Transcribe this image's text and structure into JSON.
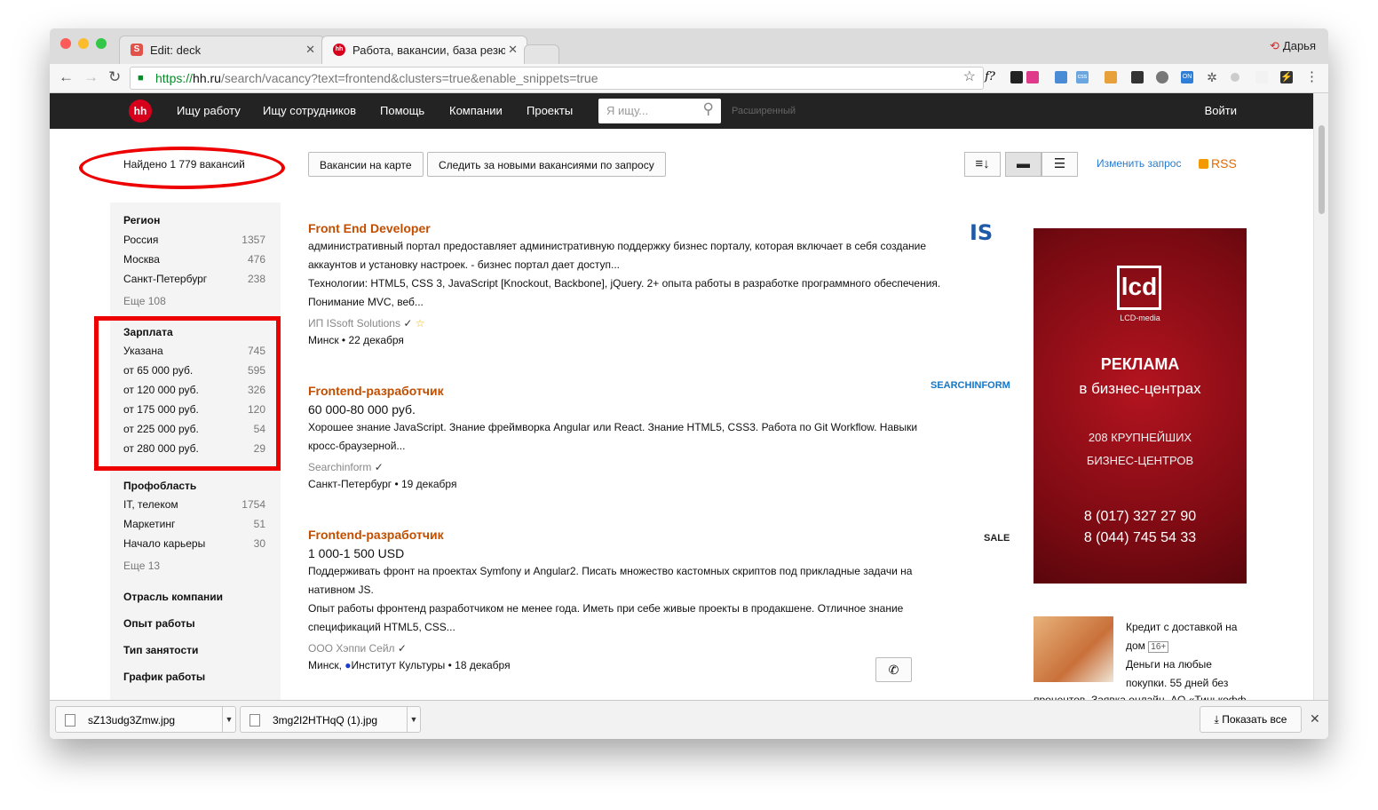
{
  "browser": {
    "tabs": [
      {
        "title": "Edit: deck",
        "favicon": "S"
      },
      {
        "title": "Работа, вакансии, база резю",
        "favicon": "hh"
      }
    ],
    "profile": "Дарья",
    "url_https": "https://",
    "url_host": "hh.ru",
    "url_path": "/search/vacancy?text=frontend&clusters=true&enable_snippets=true"
  },
  "header": {
    "logo": "hh",
    "nav": [
      "Ищу работу",
      "Ищу сотрудников",
      "Помощь",
      "Компании",
      "Проекты"
    ],
    "search_placeholder": "Я ищу...",
    "advanced": "Расширенный",
    "login": "Войти"
  },
  "toolbar": {
    "found": "Найдено 1 779 вакансий",
    "map_button": "Вакансии на карте",
    "follow_button": "Следить за новыми вакансиями по запросу",
    "change_query": "Изменить запрос",
    "rss": "RSS"
  },
  "sidebar": {
    "region": {
      "title": "Регион",
      "items": [
        {
          "label": "Россия",
          "count": "1357"
        },
        {
          "label": "Москва",
          "count": "476"
        },
        {
          "label": "Санкт-Петербург",
          "count": "238"
        }
      ],
      "more": "Еще 108"
    },
    "salary": {
      "title": "Зарплата",
      "items": [
        {
          "label": "Указана",
          "count": "745"
        },
        {
          "label": "от 65 000 руб.",
          "count": "595"
        },
        {
          "label": "от 120 000 руб.",
          "count": "326"
        },
        {
          "label": "от 175 000 руб.",
          "count": "120"
        },
        {
          "label": "от 225 000 руб.",
          "count": "54"
        },
        {
          "label": "от 280 000 руб.",
          "count": "29"
        }
      ]
    },
    "profarea": {
      "title": "Профобласть",
      "items": [
        {
          "label": "IT, телеком",
          "count": "1754"
        },
        {
          "label": "Маркетинг",
          "count": "51"
        },
        {
          "label": "Начало карьеры",
          "count": "30"
        }
      ],
      "more": "Еще 13"
    },
    "collapsed": [
      "Отрасль компании",
      "Опыт работы",
      "Тип занятости",
      "График работы"
    ]
  },
  "vacancies": [
    {
      "title": "Front End Developer",
      "salary": "",
      "snippet1": "административный портал предоставляет административную поддержку бизнес порталу, которая включает в себя создание аккаунтов и установку настроек. - бизнес портал дает доступ...",
      "snippet2": "Технологии: HTML5, CSS 3, JavaScript [Knockout, Backbone], jQuery. 2+ опыта работы в разработке программного обеспечения. Понимание MVC, веб...",
      "employer": "ИП ISsoft Solutions",
      "city": "Минск",
      "date": "22 декабря",
      "logo": "IS"
    },
    {
      "title": "Frontend-разработчик",
      "salary": "60 000-80 000 руб.",
      "snippet1": "Хорошее знание JavaScript. Знание фреймворка Angular или React. Знание HTML5, CSS3. Работа по Git Workflow. Навыки кросс-браузерной...",
      "snippet2": "",
      "employer": "Searchinform",
      "city": "Санкт-Петербург",
      "date": "19 декабря",
      "logo": "SEARCHINFORM"
    },
    {
      "title": "Frontend-разработчик",
      "salary": "1 000-1 500 USD",
      "snippet1": "Поддерживать фронт на проектах Symfony и Angular2. Писать множество кастомных скриптов под прикладные задачи на нативном JS.",
      "snippet2": "Опыт работы фронтенд разработчиком не менее года. Иметь при себе живые проекты в продакшене. Отличное знание спецификаций HTML5, CSS...",
      "employer": "ООО Хэппи Сейл",
      "city": "Минск,",
      "metro": "Институт Культуры",
      "date": "18 декабря",
      "logo": "SALE"
    }
  ],
  "ad": {
    "logo": "lcd",
    "brand": "LCD-media",
    "line1": "РЕКЛАМА",
    "line2": "в бизнес-центрах",
    "line3": "208 КРУПНЕЙШИХ",
    "line4": "БИЗНЕС-ЦЕНТРОВ",
    "phone1": "8 (017) 327 27 90",
    "phone2": "8 (044) 745 54 33"
  },
  "ad2": {
    "title": "Кредит с доставкой на дом",
    "age": "16+",
    "text": "Деньги на любые покупки. 55 дней без",
    "text2": "процентов. Заявка онлайн. АО «Тинькофф"
  },
  "downloads": {
    "files": [
      "sZ13udg3Zmw.jpg",
      "3mg2I2HTHqQ (1).jpg"
    ],
    "show_all": "Показать все"
  }
}
